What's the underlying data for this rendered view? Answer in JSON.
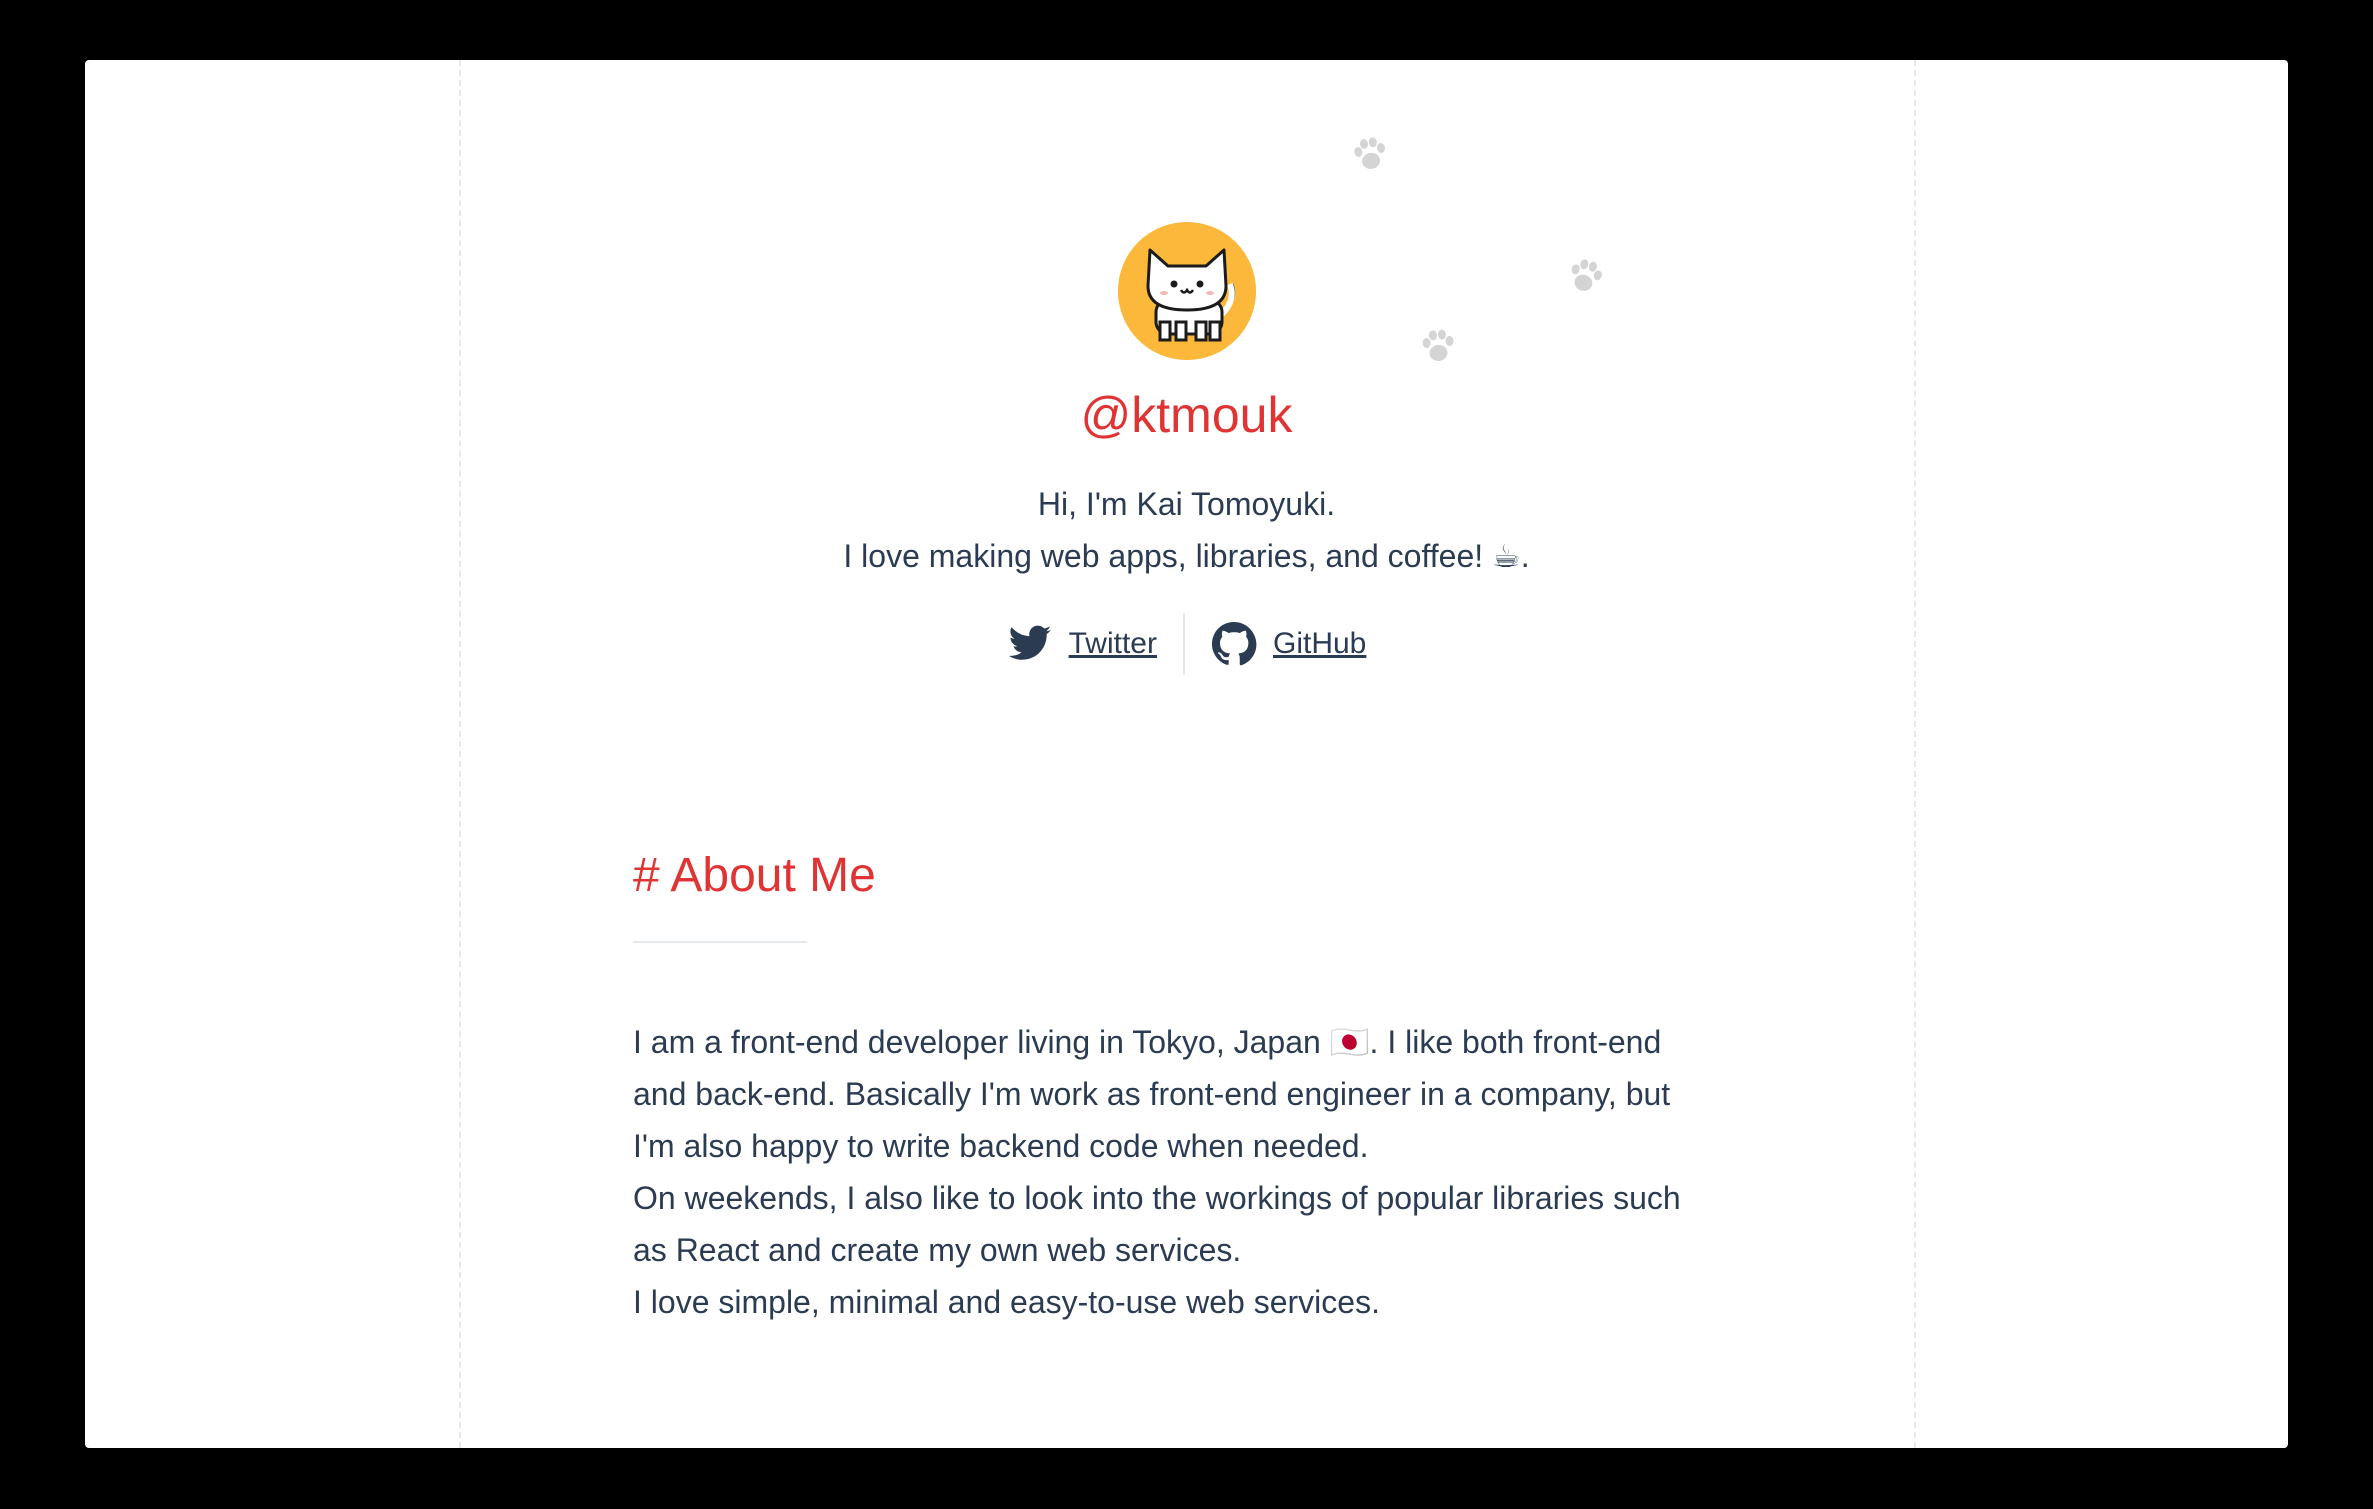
{
  "profile": {
    "handle": "@ktmouk",
    "bio_line1": "Hi, I'm Kai Tomoyuki.",
    "bio_line2": "I love making web apps, libraries, and coffee! ☕."
  },
  "social": {
    "twitter_label": "Twitter",
    "github_label": "GitHub"
  },
  "about": {
    "title": "# About Me",
    "lines": [
      "I am a front-end developer living in Tokyo, Japan 🇯🇵. I like both front-end",
      "and back-end. Basically I'm work as front-end engineer in a company, but",
      "I'm also happy to write backend code when needed.",
      "On weekends, I also like to look into the workings of popular libraries such",
      "as React and create my own web services.",
      "I love simple, minimal and easy-to-use web services."
    ]
  },
  "icons": {
    "avatar": "white-cat-avatar",
    "paws": "paw-print-icon",
    "twitter": "twitter-bird-icon",
    "github": "github-octocat-icon"
  },
  "colors": {
    "accent": "#e03434",
    "text": "#2b3b52",
    "avatar_bg": "#fbb83b",
    "paw": "#d6d6d6"
  }
}
